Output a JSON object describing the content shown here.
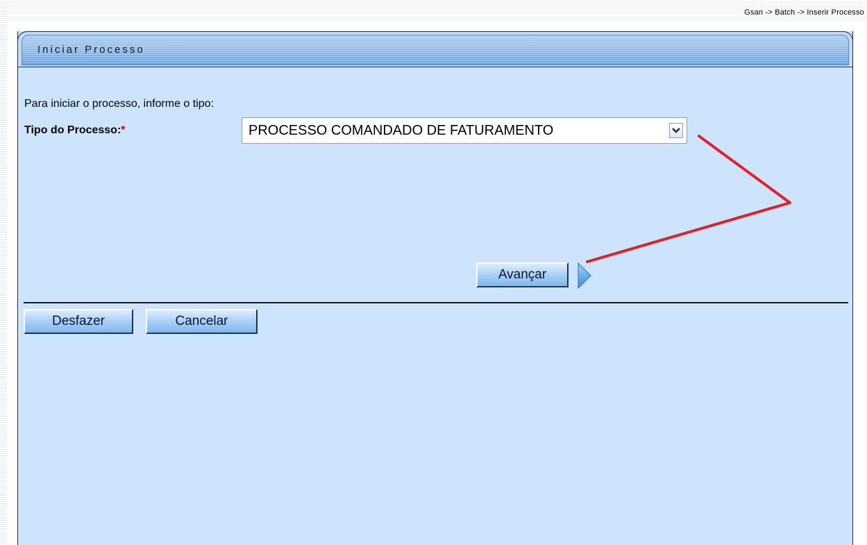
{
  "breadcrumb": "Gsan -> Batch -> Inserir Processo",
  "panel": {
    "title": "Iniciar Processo",
    "intro": "Para iniciar o processo, informe o tipo:",
    "field_label": "Tipo do Processo:",
    "required_mark": "*",
    "select_value": "PROCESSO COMANDADO DE FATURAMENTO"
  },
  "buttons": {
    "avancar": "Avançar",
    "desfazer": "Desfazer",
    "cancelar": "Cancelar"
  },
  "icons": {
    "dropdown": "chevron-down-icon",
    "next": "arrow-right-icon"
  },
  "colors": {
    "panel_bg": "#cce5fc",
    "annotation": "#e0202a"
  }
}
